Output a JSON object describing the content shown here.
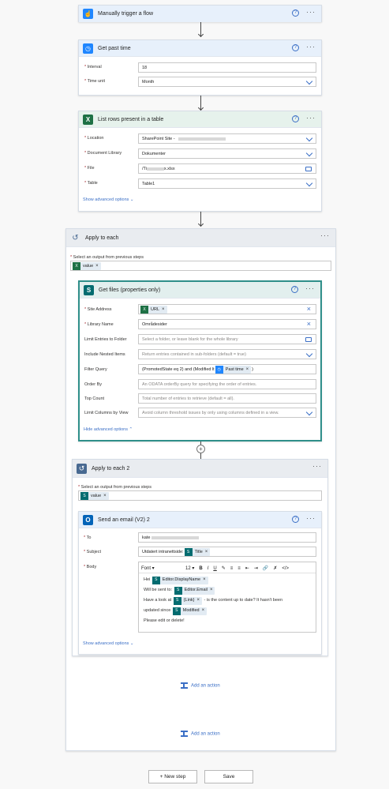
{
  "trigger": {
    "title": "Manually trigger a flow"
  },
  "get_past_time": {
    "title": "Get past time",
    "interval_label": "Interval",
    "interval_value": "18",
    "unit_label": "Time unit",
    "unit_value": "Month"
  },
  "list_rows": {
    "title": "List rows present in a table",
    "location_label": "Location",
    "location_value": "SharePoint Site - ",
    "library_label": "Document Library",
    "library_value": "Dokumenter",
    "file_label": "File",
    "file_value": "/Ti",
    "file_suffix": "x.xlsx",
    "table_label": "Table",
    "table_value": "Table1",
    "advanced_link": "Show advanced options"
  },
  "apply_each": {
    "title": "Apply to each",
    "select_label": "Select an output from previous steps",
    "token": "value"
  },
  "get_files": {
    "title": "Get files (properties only)",
    "site_label": "Site Address",
    "site_token": "URL",
    "library_label": "Library Name",
    "library_value": "Områdesider",
    "limit_label": "Limit Entries to Folder",
    "limit_ph": "Select a folder, or leave blank for the whole library",
    "nested_label": "Include Nested Items",
    "nested_ph": "Return entries contained in sub-folders (default = true)",
    "filter_label": "Filter Query",
    "filter_text": "(PromotedState eq 2) and (Modified lt",
    "filter_token": "Past time",
    "filter_end": ")",
    "order_label": "Order By",
    "order_ph": "An ODATA orderBy query for specifying the order of entries.",
    "top_label": "Top Count",
    "top_ph": "Total number of entries to retrieve (default = all).",
    "columns_label": "Limit Columns by View",
    "columns_ph": "Avoid column threshold issues by only using columns defined in a view.",
    "advanced_link": "Hide advanced options"
  },
  "apply_each2": {
    "title": "Apply to each 2",
    "select_label": "Select an output from previous steps",
    "token": "value"
  },
  "send_email": {
    "title": "Send an email (V2) 2",
    "to_label": "To",
    "to_value": "kate",
    "subject_label": "Subject",
    "subject_text": "Utdatert intranettside:",
    "subject_token": "Title",
    "body_label": "Body",
    "font_label": "Font",
    "font_size": "12",
    "line1_text": "Hei",
    "line1_token": "Editor.DisplayName",
    "line2_text": "Will be sent to:",
    "line2_token": "Editor.Email",
    "line3_text": "Have a look at",
    "line3_token": "{Link}",
    "line3_end": "- is the content up to date? It hasn't been",
    "line4_text": "updated since",
    "line4_token": "Modified",
    "line5_text": "Please edit or delete!",
    "advanced_link": "Show advanced options"
  },
  "add_action_inner": "Add an action",
  "add_action_outer": "Add an action",
  "new_step": "+ New step",
  "save": "Save",
  "colors": {
    "link": "#3b6fc6",
    "excel": "#1e7145",
    "sharepoint": "#036c70",
    "trigger": "#1f86ff"
  }
}
